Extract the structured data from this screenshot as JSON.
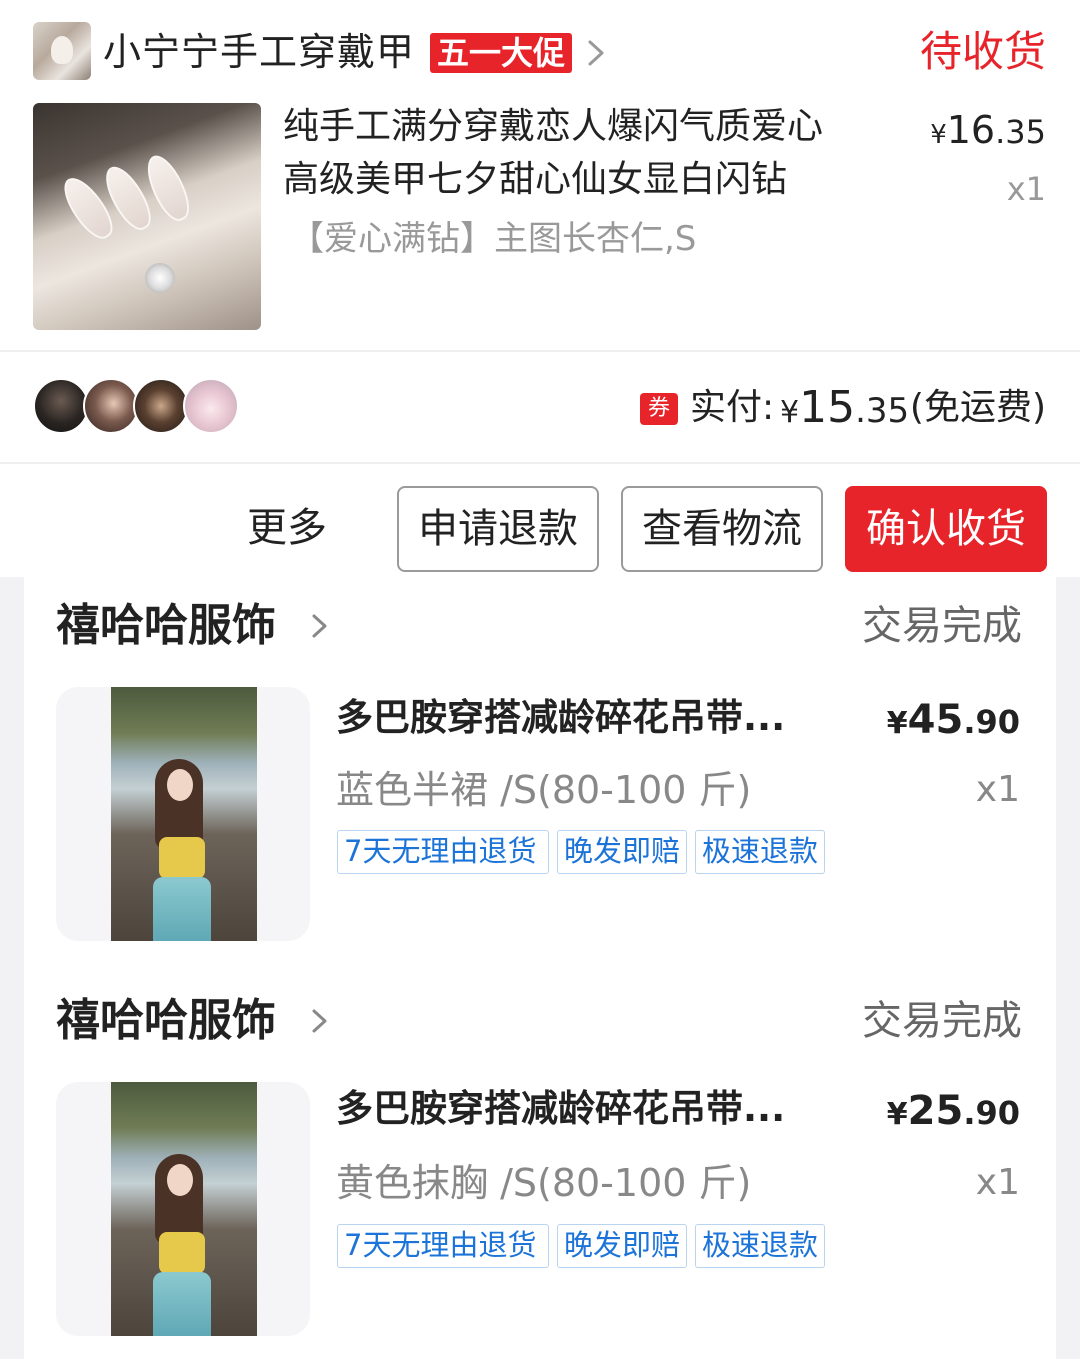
{
  "order1": {
    "shop_name": "小宁宁手工穿戴甲",
    "promo_badge": "五一大促",
    "status": "待收货",
    "product": {
      "title_line1": "纯手工满分穿戴恋人爆闪气质爱心",
      "title_line2": "高级美甲七夕甜心仙女显白闪钻",
      "spec": "【爱心满钻】主图长杏仁,S",
      "price_currency": "¥",
      "price_int": "16",
      "price_dec": ".35",
      "qty": "x1"
    },
    "coupon_icon": "券",
    "paid_label": "实付:",
    "paid_currency": "¥",
    "paid_int": "15",
    "paid_dec": ".35",
    "paid_shipping": "(免运费)",
    "actions": {
      "more": "更多",
      "refund": "申请退款",
      "logistics": "查看物流",
      "confirm": "确认收货"
    }
  },
  "orders": [
    {
      "store": "禧哈哈服饰",
      "status": "交易完成",
      "title": "多巴胺穿搭减龄碎花吊带...",
      "spec": "蓝色半裙 /S(80-100 斤)",
      "price_currency": "¥",
      "price_int": "45",
      "price_dec": ".90",
      "qty": "x1",
      "tags": [
        "7天无理由退货",
        "晚发即赔",
        "极速退款"
      ]
    },
    {
      "store": "禧哈哈服饰",
      "status": "交易完成",
      "title": "多巴胺穿搭减龄碎花吊带...",
      "spec": "黄色抹胸 /S(80-100 斤)",
      "price_currency": "¥",
      "price_int": "25",
      "price_dec": ".90",
      "qty": "x1",
      "tags": [
        "7天无理由退货",
        "晚发即赔",
        "极速退款"
      ]
    }
  ],
  "colors": {
    "accent_red": "#e8242b",
    "tag_blue": "#1d74d8",
    "muted_text": "#999999"
  },
  "icons": {
    "shop_chevron": "chevron-right-icon",
    "store_chevron": "chevron-right-icon",
    "coupon": "coupon-icon"
  }
}
